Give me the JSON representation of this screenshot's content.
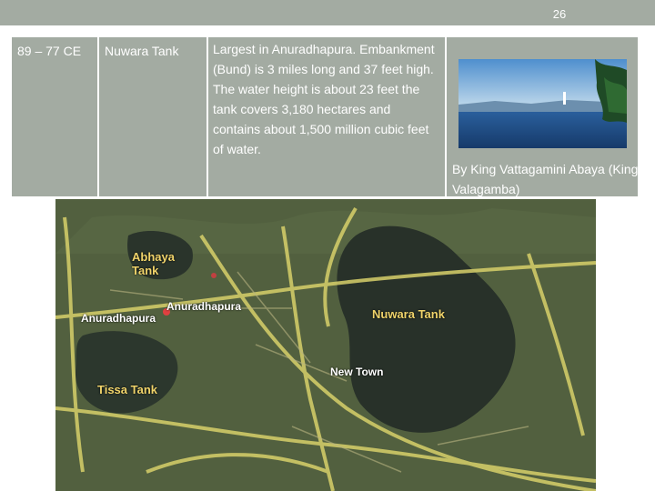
{
  "slide": {
    "page_number": "26"
  },
  "table": {
    "period": "89 – 77 CE",
    "tank_name": "Nuwara Tank",
    "description": "Largest in Anuradhapura. Embankment (Bund) is 3 miles long and 37 feet high. The water height is about 23 feet the tank covers 3,180 hectares and contains about 1,500 million cubic feet of water.",
    "builder": "By King Vattagamini Abaya (King Valagamba)"
  },
  "map": {
    "labels": {
      "abhaya": "Abhaya Tank",
      "tissa": "Tissa Tank",
      "nuwara": "Nuwara Tank",
      "anuradhapura_city": "Anuradhapura",
      "anuradhapura_pin": "Anuradhapura",
      "new_town": "New Town"
    }
  }
}
